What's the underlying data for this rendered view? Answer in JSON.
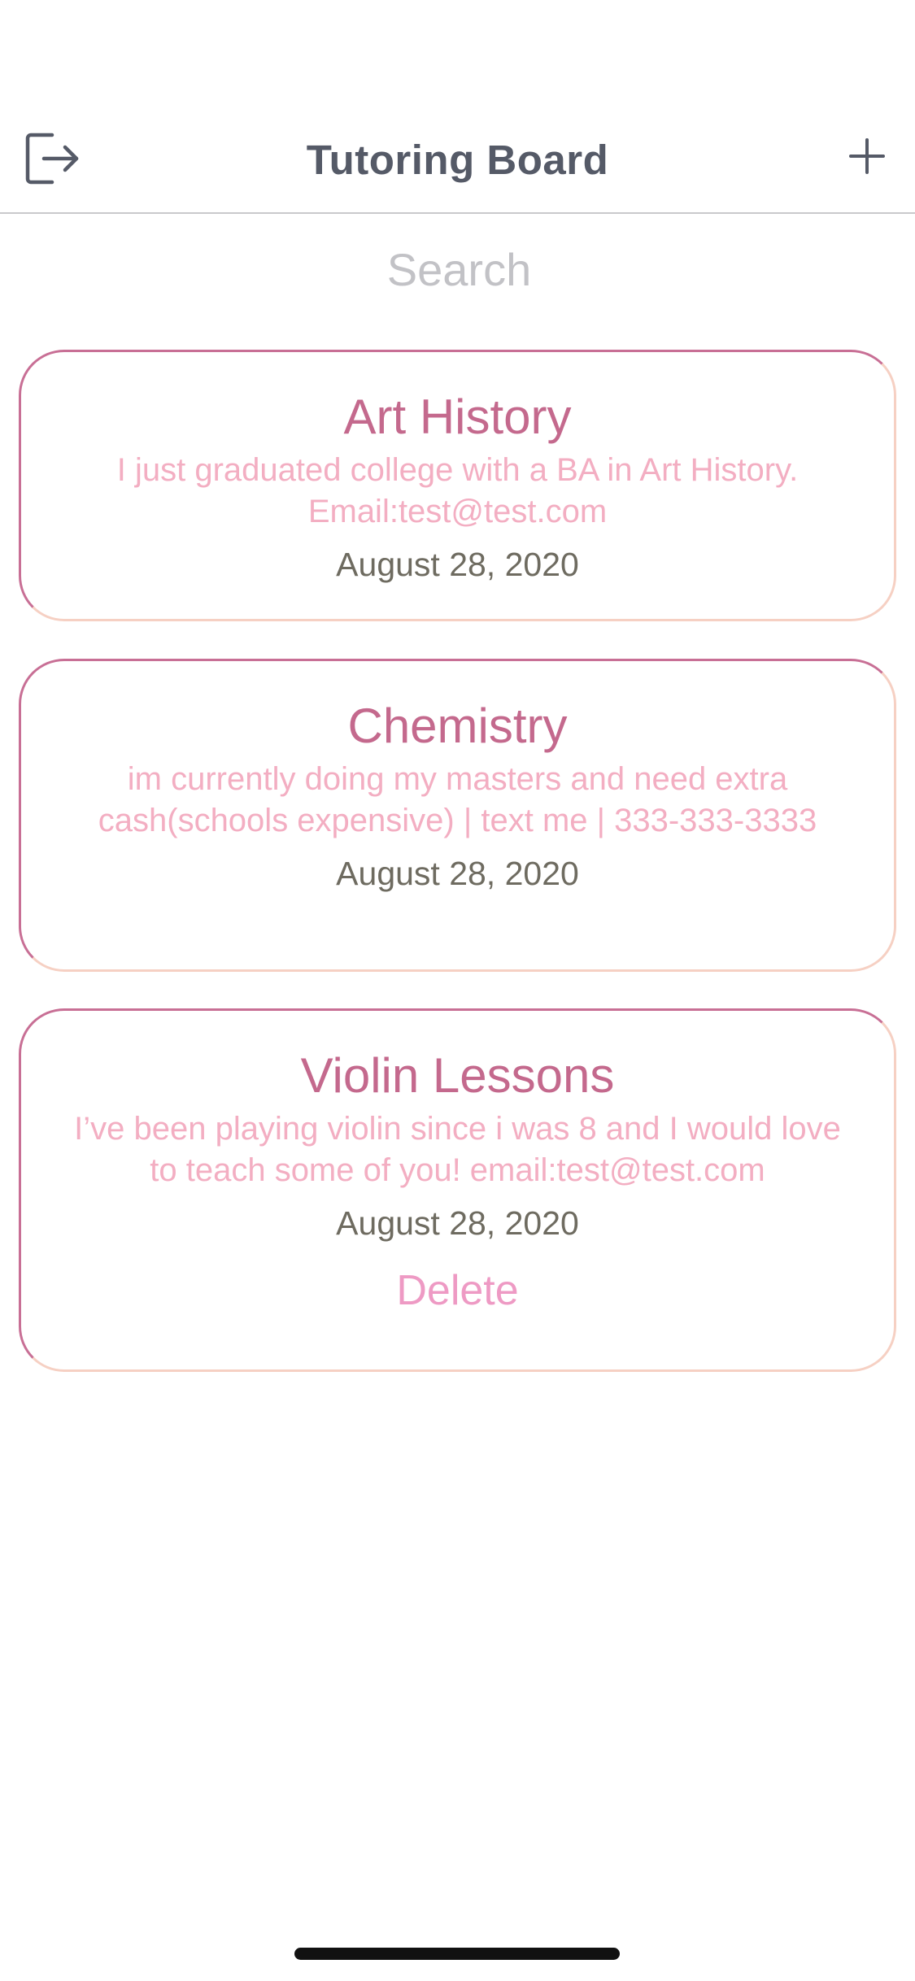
{
  "header": {
    "title": "Tutoring Board",
    "logout_icon": "logout-icon",
    "add_icon": "plus-icon"
  },
  "search": {
    "placeholder": "Search",
    "value": ""
  },
  "posts": [
    {
      "title": "Art History",
      "description": "I just graduated college with a BA in Art History. Email:test@test.com",
      "date": "August 28, 2020"
    },
    {
      "title": "Chemistry",
      "description": "im currently doing my masters and need extra cash(schools expensive) | text me | 333-333-3333",
      "date": "August 28, 2020"
    },
    {
      "title": "Violin Lessons",
      "description": "I’ve been playing violin since i was 8 and I would love to teach some of you! email:test@test.com",
      "date": "August 28, 2020",
      "delete_label": "Delete"
    }
  ],
  "colors": {
    "title_text": "#555a67",
    "card_title": "#c4698d",
    "card_description": "#f3aec2",
    "card_date": "#6e6b60",
    "delete": "#ee9ac4",
    "card_border_primary": "#c86f95",
    "card_border_secondary": "#f6d0c3"
  }
}
